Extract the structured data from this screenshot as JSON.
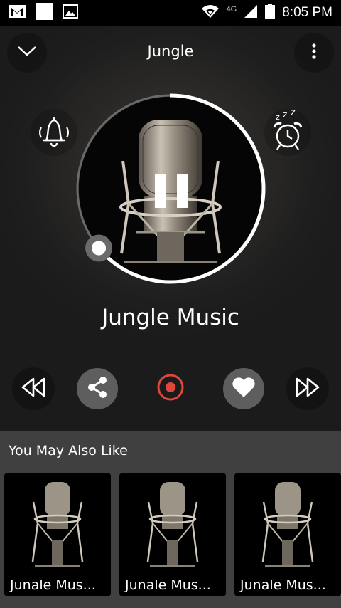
{
  "status_bar": {
    "network": "4G",
    "time": "8:05 PM",
    "icons": [
      "gmail-icon",
      "blank-notification-icon",
      "image-icon",
      "wifi-icon",
      "signal-icon",
      "battery-icon"
    ]
  },
  "header": {
    "title": "Jungle",
    "collapse_icon": "chevron-down-icon",
    "menu_icon": "more-vertical-icon"
  },
  "player": {
    "song_title": "Jungle Music",
    "state": "playing",
    "progress_fraction": 0.64,
    "left_icon": "bell-ringing-icon",
    "right_icon": "alarm-snooze-icon"
  },
  "controls": [
    "rewind-icon",
    "share-icon",
    "record-icon",
    "heart-icon",
    "fast-forward-icon"
  ],
  "colors": {
    "record": "#e0463c",
    "background": "#1e1e1e",
    "section": "#404040"
  },
  "also_like": {
    "heading": "You May Also Like",
    "items": [
      {
        "label": "Junale Mus..."
      },
      {
        "label": "Junale Mus..."
      },
      {
        "label": "Junale Mus..."
      }
    ]
  }
}
